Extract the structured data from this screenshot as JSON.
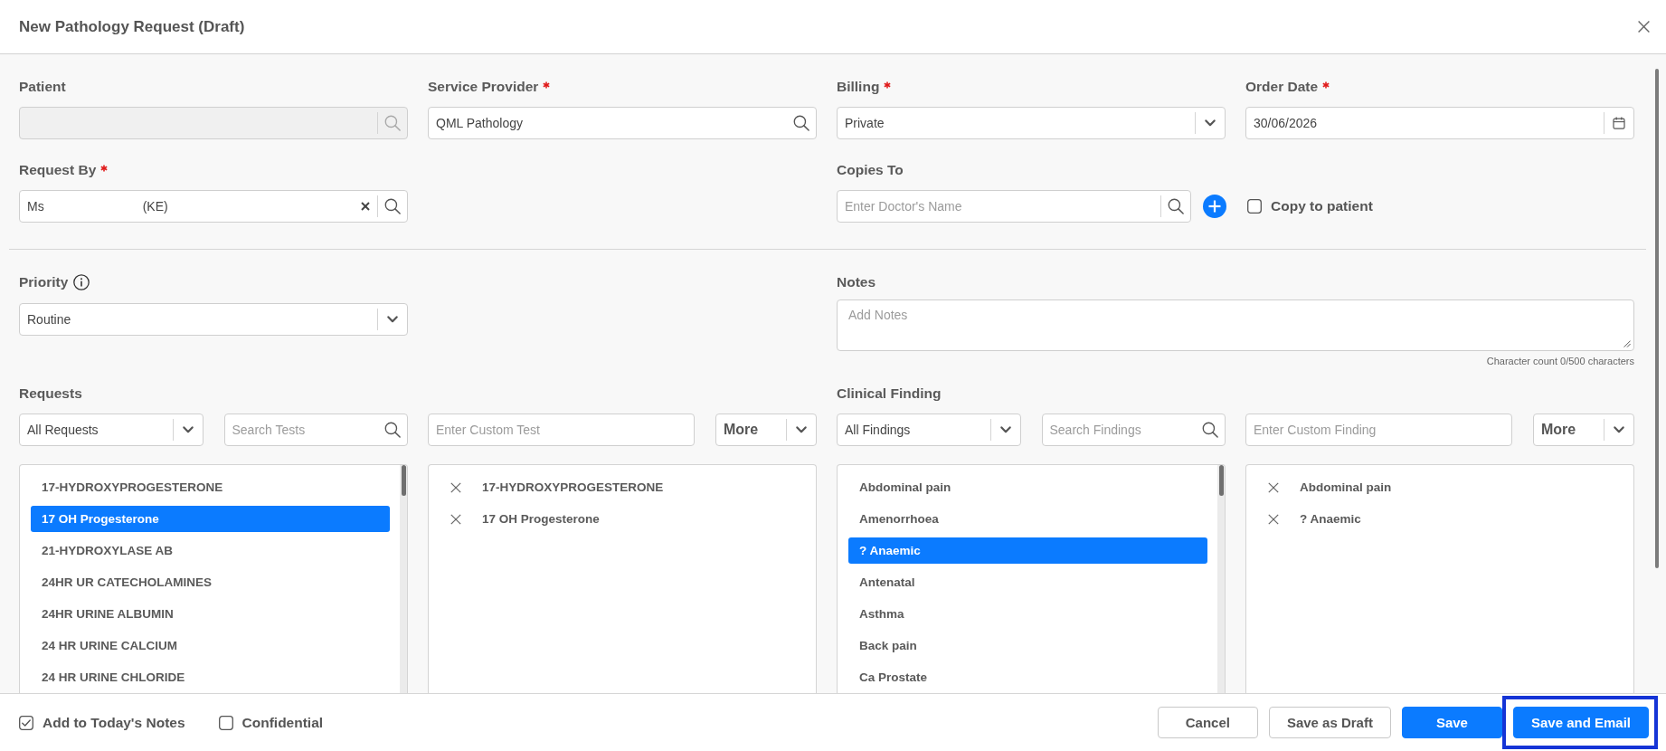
{
  "dialog": {
    "title": "New Pathology Request (Draft)"
  },
  "fields": [
    {
      "label": "Patient",
      "required": false,
      "kind": "lookup",
      "disabled": true
    },
    {
      "label": "Service Provider",
      "required": true,
      "kind": "search",
      "disabled": false,
      "value": "QML Pathology"
    },
    {
      "label": "Billing",
      "required": true,
      "kind": "dropdown",
      "disabled": false,
      "value": "Private"
    },
    {
      "label": "Order Date",
      "required": true,
      "kind": "date",
      "disabled": false,
      "value": "30/06/2026"
    }
  ],
  "request_by": {
    "label": "Request By",
    "required": true,
    "value_parts": [
      "Ms",
      "(KE)"
    ]
  },
  "copies_to": {
    "label": "Copies To",
    "required": false,
    "placeholder": "Enter Doctor's Name",
    "copy_to_patient": {
      "label": "Copy to patient",
      "checked": false
    }
  },
  "priority": {
    "label": "Priority",
    "value": "Routine"
  },
  "notes": {
    "label": "Notes",
    "placeholder": "Add Notes",
    "character_count": "Character count 0/500 characters"
  },
  "requests": {
    "label": "Requests",
    "filter": "All Requests",
    "search_placeholder": "Search Tests",
    "custom_placeholder": "Enter Custom Test",
    "more": "More",
    "available": [
      {
        "name": "17-HYDROXYPROGESTERONE",
        "selected": false
      },
      {
        "name": "17 OH Progesterone",
        "selected": true
      },
      {
        "name": "21-HYDROXYLASE AB",
        "selected": false
      },
      {
        "name": "24HR UR CATECHOLAMINES",
        "selected": false
      },
      {
        "name": "24HR URINE ALBUMIN",
        "selected": false
      },
      {
        "name": "24 HR URINE CALCIUM",
        "selected": false
      },
      {
        "name": "24 HR URINE CHLORIDE",
        "selected": false
      }
    ],
    "chosen": [
      "17-HYDROXYPROGESTERONE",
      "17 OH Progesterone"
    ]
  },
  "clinical_finding": {
    "label": "Clinical Finding",
    "filter": "All Findings",
    "search_placeholder": "Search Findings",
    "custom_placeholder": "Enter Custom Finding",
    "more": "More",
    "available": [
      {
        "name": "Abdominal pain",
        "selected": false
      },
      {
        "name": "Amenorrhoea",
        "selected": false
      },
      {
        "name": "? Anaemic",
        "selected": true
      },
      {
        "name": "Antenatal",
        "selected": false
      },
      {
        "name": "Asthma",
        "selected": false
      },
      {
        "name": "Back pain",
        "selected": false
      },
      {
        "name": "Ca Prostate",
        "selected": false
      }
    ],
    "chosen": [
      "Abdominal pain",
      "? Anaemic"
    ]
  },
  "footer": {
    "options": [
      {
        "label": "Add to Today's Notes",
        "checked": true
      },
      {
        "label": "Confidential",
        "checked": false
      }
    ],
    "buttons": [
      {
        "label": "Cancel",
        "kind": "secondary",
        "highlighted": false
      },
      {
        "label": "Save as Draft",
        "kind": "secondary",
        "highlighted": false
      },
      {
        "label": "Save",
        "kind": "primary",
        "highlighted": false
      },
      {
        "label": "Save and Email",
        "kind": "primary",
        "highlighted": true
      }
    ]
  }
}
